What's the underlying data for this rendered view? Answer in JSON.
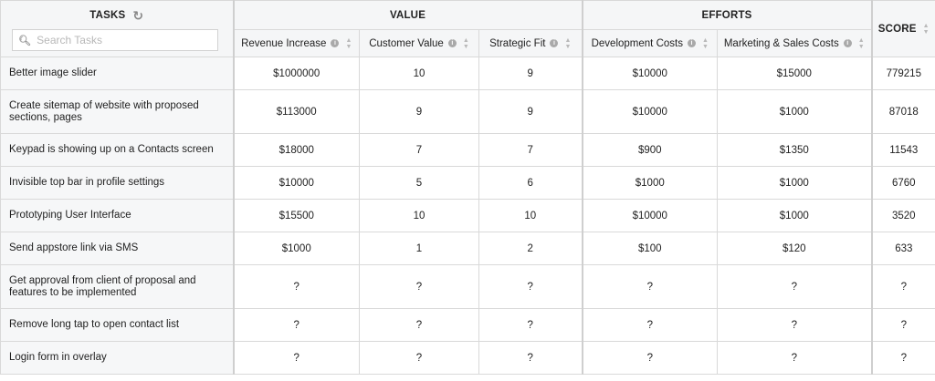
{
  "header": {
    "tasks_label": "TASKS",
    "search_placeholder": "Search Tasks",
    "groups": {
      "value": "VALUE",
      "efforts": "EFFORTS",
      "score": "SCORE"
    },
    "columns": [
      "Revenue Increase",
      "Customer Value",
      "Strategic Fit",
      "Development Costs",
      "Marketing & Sales Costs"
    ]
  },
  "rows": [
    {
      "task": "Better image slider",
      "revenue": "$1000000",
      "customer_value": "10",
      "strategic_fit": "9",
      "dev_costs": "$10000",
      "mkt_costs": "$15000",
      "score": "779215"
    },
    {
      "task": "Create sitemap of website with proposed sections, pages",
      "revenue": "$113000",
      "customer_value": "9",
      "strategic_fit": "9",
      "dev_costs": "$10000",
      "mkt_costs": "$1000",
      "score": "87018"
    },
    {
      "task": "Keypad is showing up on a Contacts screen",
      "revenue": "$18000",
      "customer_value": "7",
      "strategic_fit": "7",
      "dev_costs": "$900",
      "mkt_costs": "$1350",
      "score": "11543"
    },
    {
      "task": "Invisible top bar in profile settings",
      "revenue": "$10000",
      "customer_value": "5",
      "strategic_fit": "6",
      "dev_costs": "$1000",
      "mkt_costs": "$1000",
      "score": "6760"
    },
    {
      "task": "Prototyping User Interface",
      "revenue": "$15500",
      "customer_value": "10",
      "strategic_fit": "10",
      "dev_costs": "$10000",
      "mkt_costs": "$1000",
      "score": "3520"
    },
    {
      "task": "Send appstore link via SMS",
      "revenue": "$1000",
      "customer_value": "1",
      "strategic_fit": "2",
      "dev_costs": "$100",
      "mkt_costs": "$120",
      "score": "633"
    },
    {
      "task": "Get approval from client of proposal and features to be implemented",
      "revenue": "?",
      "customer_value": "?",
      "strategic_fit": "?",
      "dev_costs": "?",
      "mkt_costs": "?",
      "score": "?"
    },
    {
      "task": "Remove long tap to open contact list",
      "revenue": "?",
      "customer_value": "?",
      "strategic_fit": "?",
      "dev_costs": "?",
      "mkt_costs": "?",
      "score": "?"
    },
    {
      "task": "Login form in overlay",
      "revenue": "?",
      "customer_value": "?",
      "strategic_fit": "?",
      "dev_costs": "?",
      "mkt_costs": "?",
      "score": "?"
    }
  ]
}
